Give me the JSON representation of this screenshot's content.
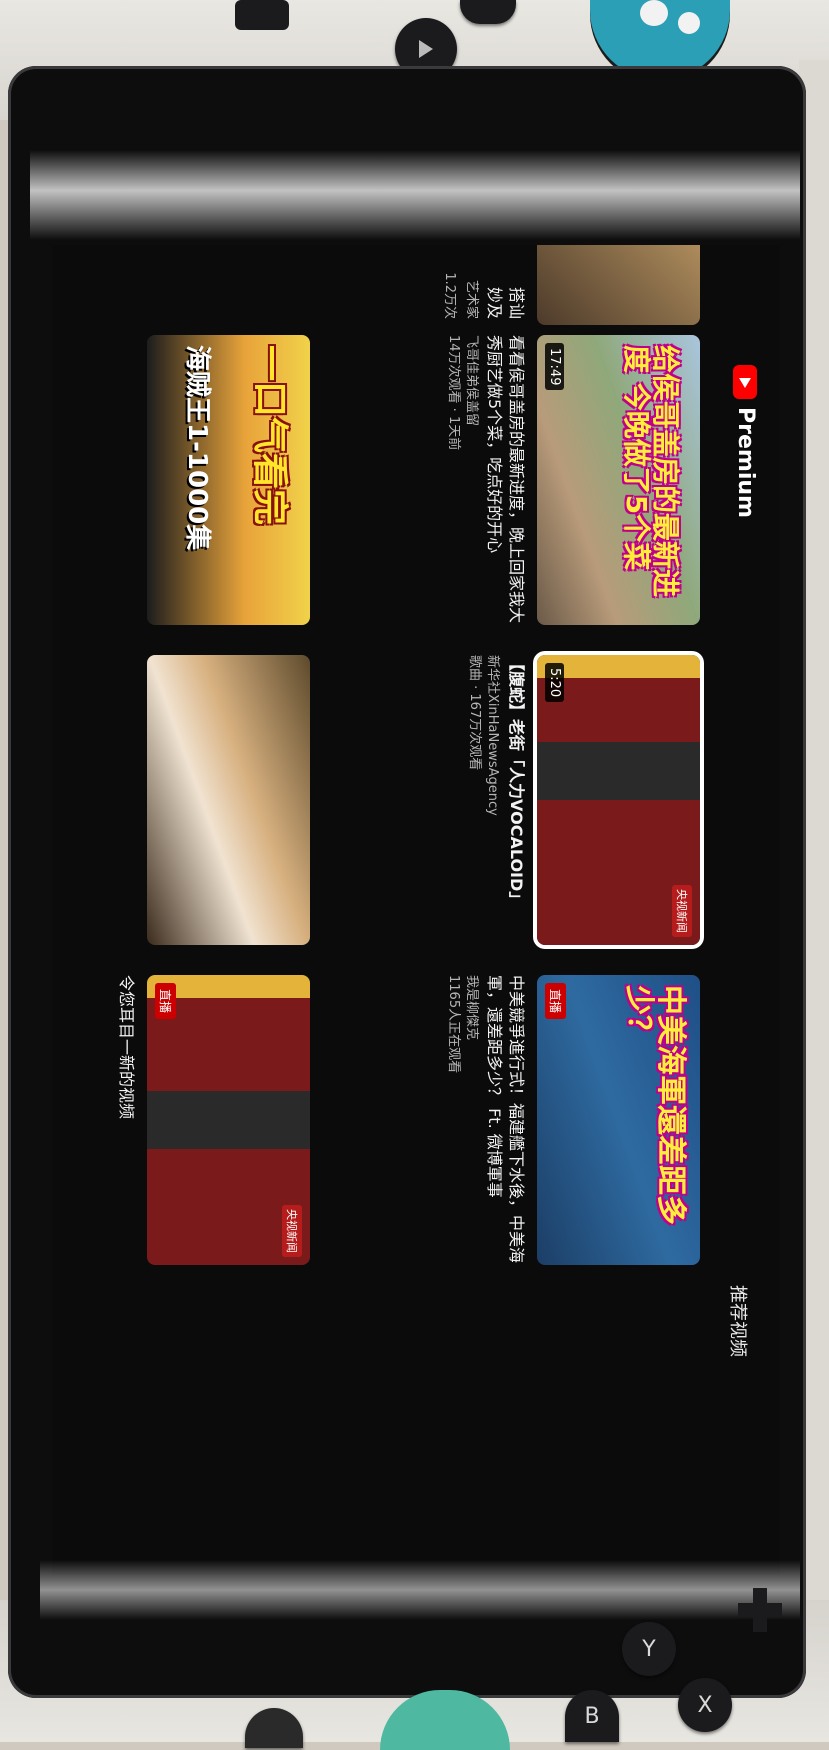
{
  "screen": {
    "brand": "Premium",
    "section_title": "推荐视频",
    "videos": [
      {
        "overlay": "给侯哥盖房的最新进度 今晚做了5个菜",
        "duration": "17:49",
        "title": "看看侯哥盖房的最新进度，晚上回家我大秀厨艺做5个菜，吃点好的开心",
        "channel": "飞哥佳弟侯盖留",
        "stats": "14万次观看 · 1天前"
      },
      {
        "duration": "5:20",
        "badge": "央视新闻",
        "title": "【腹蛇】老街「人力VOCALOID」",
        "channel": "新华社XinHaNewsAgency",
        "stats": "歌曲 · 167万次观看"
      },
      {
        "overlay": "中美海軍還差距多少？",
        "live": "直播",
        "title": "中美競爭進行式！福建艦下水後，中美海軍，還差距多少？ Ft. 微博軍事",
        "channel": "我是柳傑克",
        "stats": "1165人正在观看"
      },
      {
        "overlay": "一口气看完",
        "overlay2": "海贼王1-1000集"
      },
      {
        "title": ""
      },
      {
        "badge": "央视新闻",
        "live": "直播",
        "title": "令您耳目一新的视频"
      }
    ],
    "partial_right": {
      "title": "搭讪",
      "title2": "妙及",
      "channel": "艺术家",
      "stats": "1.2万次"
    }
  },
  "console": {
    "buttons": [
      "Y",
      "X",
      "B"
    ]
  }
}
